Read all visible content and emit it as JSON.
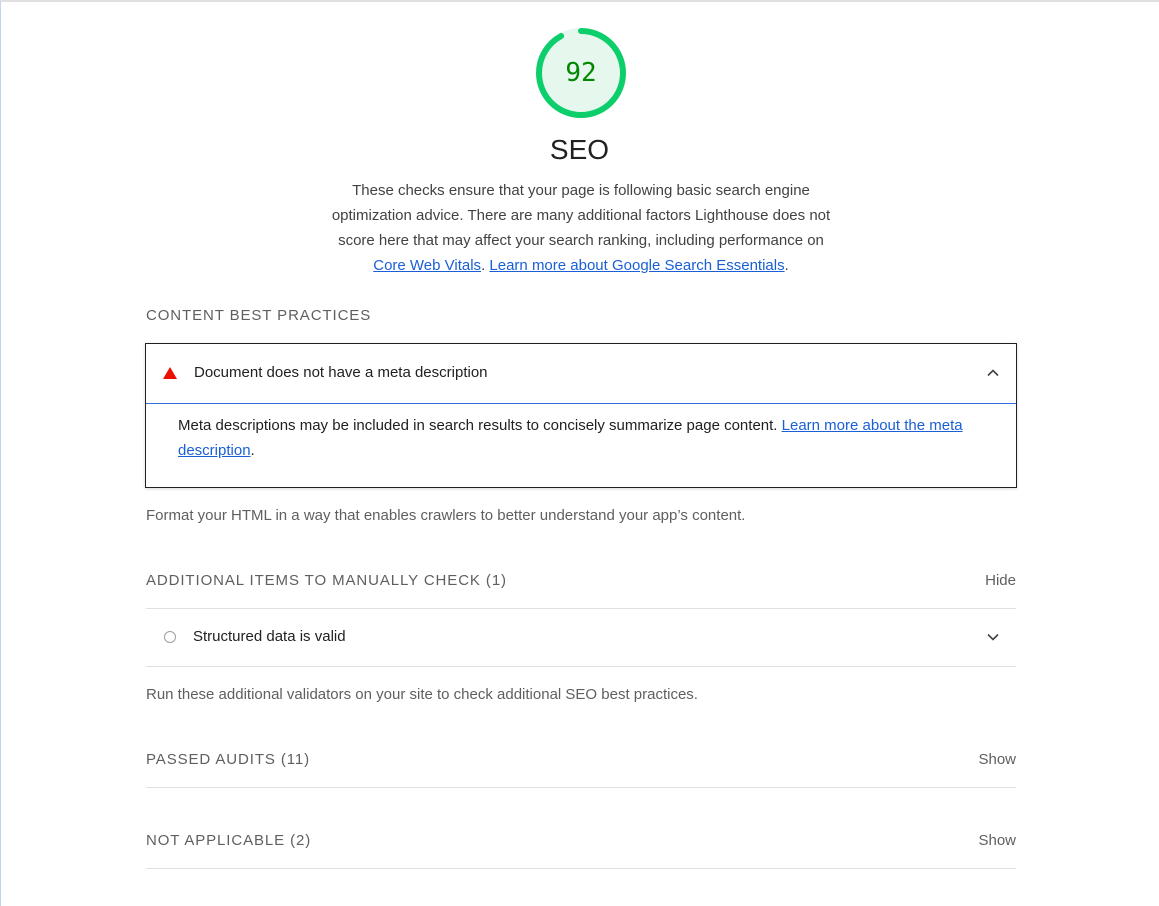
{
  "category": {
    "score": "92",
    "score_fraction": 0.92,
    "title": "SEO",
    "description_text": "These checks ensure that your page is following basic search engine optimization advice. There are many additional factors Lighthouse does not score here that may affect your search ranking, including performance on",
    "link_core_web_vitals": "Core Web Vitals",
    "separator": ".",
    "link_learn_more": "Learn more about Google Search Essentials",
    "end_punct": "."
  },
  "colors": {
    "pass_green": "#0cce6b",
    "pass_fill": "#e6f8ee",
    "score_text": "#008800",
    "fail_red": "#eb0f00",
    "link_blue": "#1a5fd6"
  },
  "content_best_practices": {
    "title": "CONTENT BEST PRACTICES",
    "audit": {
      "icon": "fail-triangle-icon",
      "title": "Document does not have a meta description",
      "expanded": true,
      "description_text": "Meta descriptions may be included in search results to concisely summarize page content.",
      "link_text": "Learn more about the meta description",
      "end_punct": "."
    },
    "group_description": "Format your HTML in a way that enables crawlers to better understand your app’s content."
  },
  "manual_checks": {
    "title": "ADDITIONAL ITEMS TO MANUALLY CHECK",
    "count": "(1)",
    "toggle_label": "Hide",
    "items": [
      {
        "icon": "manual-circle-icon",
        "title": "Structured data is valid"
      }
    ],
    "group_description": "Run these additional validators on your site to check additional SEO best practices."
  },
  "passed_audits": {
    "title": "PASSED AUDITS",
    "count": "(11)",
    "toggle_label": "Show"
  },
  "not_applicable": {
    "title": "NOT APPLICABLE",
    "count": "(2)",
    "toggle_label": "Show"
  }
}
